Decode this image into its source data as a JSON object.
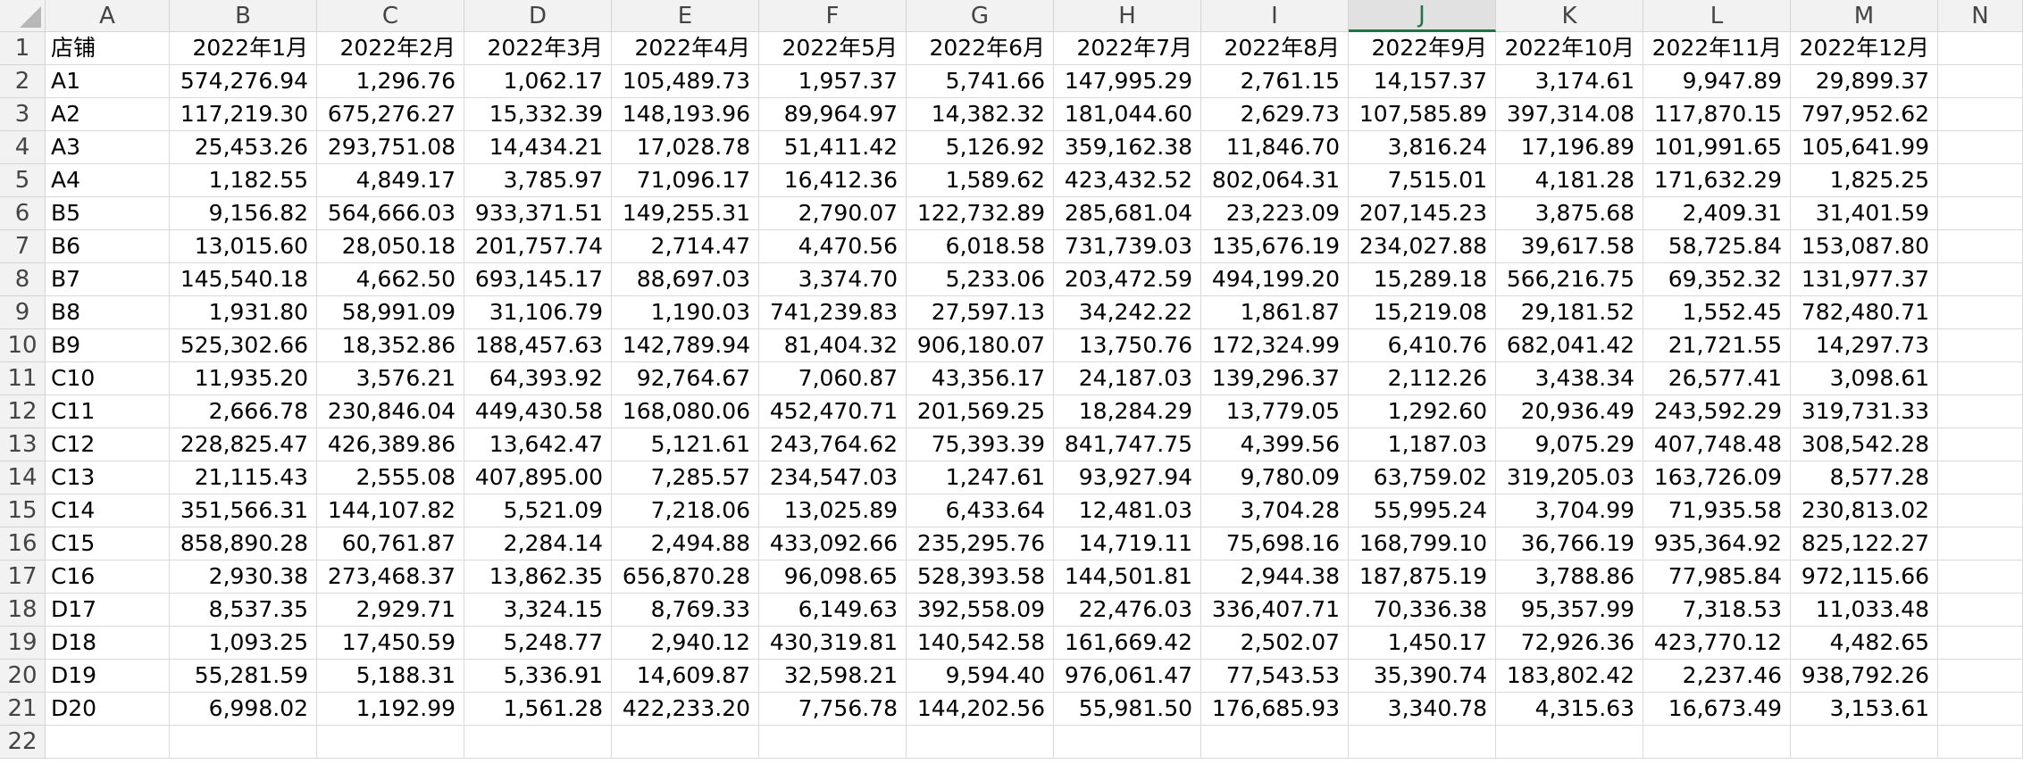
{
  "columns": [
    "A",
    "B",
    "C",
    "D",
    "E",
    "F",
    "G",
    "H",
    "I",
    "J",
    "K",
    "L",
    "M",
    "N"
  ],
  "active_column": "J",
  "row_numbers": [
    "1",
    "2",
    "3",
    "4",
    "5",
    "6",
    "7",
    "8",
    "9",
    "10",
    "11",
    "12",
    "13",
    "14",
    "15",
    "16",
    "17",
    "18",
    "19",
    "20",
    "21",
    "22"
  ],
  "header_row": [
    "店铺",
    "2022年1月",
    "2022年2月",
    "2022年3月",
    "2022年4月",
    "2022年5月",
    "2022年6月",
    "2022年7月",
    "2022年8月",
    "2022年9月",
    "2022年10月",
    "2022年11月",
    "2022年12月"
  ],
  "rows": [
    [
      "A1",
      "574,276.94",
      "1,296.76",
      "1,062.17",
      "105,489.73",
      "1,957.37",
      "5,741.66",
      "147,995.29",
      "2,761.15",
      "14,157.37",
      "3,174.61",
      "9,947.89",
      "29,899.37"
    ],
    [
      "A2",
      "117,219.30",
      "675,276.27",
      "15,332.39",
      "148,193.96",
      "89,964.97",
      "14,382.32",
      "181,044.60",
      "2,629.73",
      "107,585.89",
      "397,314.08",
      "117,870.15",
      "797,952.62"
    ],
    [
      "A3",
      "25,453.26",
      "293,751.08",
      "14,434.21",
      "17,028.78",
      "51,411.42",
      "5,126.92",
      "359,162.38",
      "11,846.70",
      "3,816.24",
      "17,196.89",
      "101,991.65",
      "105,641.99"
    ],
    [
      "A4",
      "1,182.55",
      "4,849.17",
      "3,785.97",
      "71,096.17",
      "16,412.36",
      "1,589.62",
      "423,432.52",
      "802,064.31",
      "7,515.01",
      "4,181.28",
      "171,632.29",
      "1,825.25"
    ],
    [
      "B5",
      "9,156.82",
      "564,666.03",
      "933,371.51",
      "149,255.31",
      "2,790.07",
      "122,732.89",
      "285,681.04",
      "23,223.09",
      "207,145.23",
      "3,875.68",
      "2,409.31",
      "31,401.59"
    ],
    [
      "B6",
      "13,015.60",
      "28,050.18",
      "201,757.74",
      "2,714.47",
      "4,470.56",
      "6,018.58",
      "731,739.03",
      "135,676.19",
      "234,027.88",
      "39,617.58",
      "58,725.84",
      "153,087.80"
    ],
    [
      "B7",
      "145,540.18",
      "4,662.50",
      "693,145.17",
      "88,697.03",
      "3,374.70",
      "5,233.06",
      "203,472.59",
      "494,199.20",
      "15,289.18",
      "566,216.75",
      "69,352.32",
      "131,977.37"
    ],
    [
      "B8",
      "1,931.80",
      "58,991.09",
      "31,106.79",
      "1,190.03",
      "741,239.83",
      "27,597.13",
      "34,242.22",
      "1,861.87",
      "15,219.08",
      "29,181.52",
      "1,552.45",
      "782,480.71"
    ],
    [
      "B9",
      "525,302.66",
      "18,352.86",
      "188,457.63",
      "142,789.94",
      "81,404.32",
      "906,180.07",
      "13,750.76",
      "172,324.99",
      "6,410.76",
      "682,041.42",
      "21,721.55",
      "14,297.73"
    ],
    [
      "C10",
      "11,935.20",
      "3,576.21",
      "64,393.92",
      "92,764.67",
      "7,060.87",
      "43,356.17",
      "24,187.03",
      "139,296.37",
      "2,112.26",
      "3,438.34",
      "26,577.41",
      "3,098.61"
    ],
    [
      "C11",
      "2,666.78",
      "230,846.04",
      "449,430.58",
      "168,080.06",
      "452,470.71",
      "201,569.25",
      "18,284.29",
      "13,779.05",
      "1,292.60",
      "20,936.49",
      "243,592.29",
      "319,731.33"
    ],
    [
      "C12",
      "228,825.47",
      "426,389.86",
      "13,642.47",
      "5,121.61",
      "243,764.62",
      "75,393.39",
      "841,747.75",
      "4,399.56",
      "1,187.03",
      "9,075.29",
      "407,748.48",
      "308,542.28"
    ],
    [
      "C13",
      "21,115.43",
      "2,555.08",
      "407,895.00",
      "7,285.57",
      "234,547.03",
      "1,247.61",
      "93,927.94",
      "9,780.09",
      "63,759.02",
      "319,205.03",
      "163,726.09",
      "8,577.28"
    ],
    [
      "C14",
      "351,566.31",
      "144,107.82",
      "5,521.09",
      "7,218.06",
      "13,025.89",
      "6,433.64",
      "12,481.03",
      "3,704.28",
      "55,995.24",
      "3,704.99",
      "71,935.58",
      "230,813.02"
    ],
    [
      "C15",
      "858,890.28",
      "60,761.87",
      "2,284.14",
      "2,494.88",
      "433,092.66",
      "235,295.76",
      "14,719.11",
      "75,698.16",
      "168,799.10",
      "36,766.19",
      "935,364.92",
      "825,122.27"
    ],
    [
      "C16",
      "2,930.38",
      "273,468.37",
      "13,862.35",
      "656,870.28",
      "96,098.65",
      "528,393.58",
      "144,501.81",
      "2,944.38",
      "187,875.19",
      "3,788.86",
      "77,985.84",
      "972,115.66"
    ],
    [
      "D17",
      "8,537.35",
      "2,929.71",
      "3,324.15",
      "8,769.33",
      "6,149.63",
      "392,558.09",
      "22,476.03",
      "336,407.71",
      "70,336.38",
      "95,357.99",
      "7,318.53",
      "11,033.48"
    ],
    [
      "D18",
      "1,093.25",
      "17,450.59",
      "5,248.77",
      "2,940.12",
      "430,319.81",
      "140,542.58",
      "161,669.42",
      "2,502.07",
      "1,450.17",
      "72,926.36",
      "423,770.12",
      "4,482.65"
    ],
    [
      "D19",
      "55,281.59",
      "5,188.31",
      "5,336.91",
      "14,609.87",
      "32,598.21",
      "9,594.40",
      "976,061.47",
      "77,543.53",
      "35,390.74",
      "183,802.42",
      "2,237.46",
      "938,792.26"
    ],
    [
      "D20",
      "6,998.02",
      "1,192.99",
      "1,561.28",
      "422,233.20",
      "7,756.78",
      "144,202.56",
      "55,981.50",
      "176,685.93",
      "3,340.78",
      "4,315.63",
      "16,673.49",
      "3,153.61"
    ]
  ]
}
